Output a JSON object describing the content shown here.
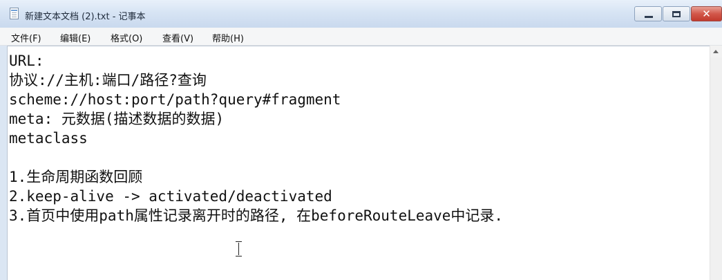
{
  "window": {
    "title": "新建文本文档 (2).txt - 记事本",
    "close_glyph": "✕"
  },
  "menu": {
    "items": [
      {
        "label": "文件(F)"
      },
      {
        "label": "编辑(E)"
      },
      {
        "label": "格式(O)"
      },
      {
        "label": "查看(V)"
      },
      {
        "label": "帮助(H)"
      }
    ]
  },
  "editor": {
    "lines": [
      "URL:",
      "协议://主机:端口/路径?查询",
      "scheme://host:port/path?query#fragment",
      "meta: 元数据(描述数据的数据)",
      "metaclass",
      "",
      "1.生命周期函数回顾",
      "2.keep-alive -> activated/deactivated",
      "3.首页中使用path属性记录离开时的路径, 在beforeRouteLeave中记录."
    ]
  },
  "icons": {
    "app": "notepad-icon",
    "cursor": "i-beam-cursor-icon",
    "scroll_up": "scroll-up-arrow-icon"
  }
}
